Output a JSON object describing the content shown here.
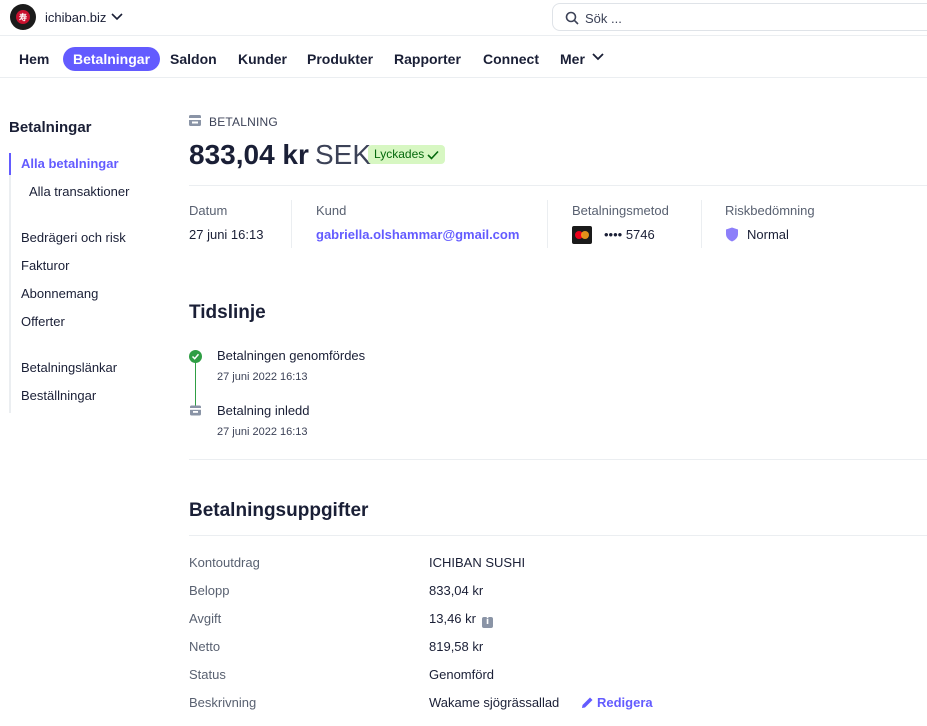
{
  "topbar": {
    "account_name": "ichiban.biz",
    "search_placeholder": "Sök ..."
  },
  "nav": {
    "items": [
      "Hem",
      "Betalningar",
      "Saldon",
      "Kunder",
      "Produkter",
      "Rapporter",
      "Connect",
      "Mer"
    ],
    "active": "Betalningar"
  },
  "sidebar": {
    "title": "Betalningar",
    "group1": [
      "Alla betalningar",
      "Alla transaktioner"
    ],
    "group2": [
      "Bedrägeri och risk",
      "Fakturor",
      "Abonnemang",
      "Offerter"
    ],
    "group3": [
      "Betalningslänkar",
      "Beställningar"
    ]
  },
  "payment": {
    "kind_label": "BETALNING",
    "amount": "833,04 kr",
    "currency": "SEK",
    "status_badge": "Lyckades",
    "meta": {
      "date_label": "Datum",
      "date_value": "27 juni 16:13",
      "customer_label": "Kund",
      "customer_value": "gabriella.olshammar@gmail.com",
      "method_label": "Betalningsmetod",
      "method_value": "•••• 5746",
      "risk_label": "Riskbedömning",
      "risk_value": "Normal"
    }
  },
  "timeline": {
    "title": "Tidslinje",
    "events": [
      {
        "title": "Betalningen genomfördes",
        "time": "27 juni 2022 16:13"
      },
      {
        "title": "Betalning inledd",
        "time": "27 juni 2022 16:13"
      }
    ]
  },
  "details": {
    "title": "Betalningsuppgifter",
    "rows": [
      {
        "label": "Kontoutdrag",
        "value": "ICHIBAN SUSHI"
      },
      {
        "label": "Belopp",
        "value": "833,04 kr"
      },
      {
        "label": "Avgift",
        "value": "13,46 kr"
      },
      {
        "label": "Netto",
        "value": "819,58 kr"
      },
      {
        "label": "Status",
        "value": "Genomförd"
      },
      {
        "label": "Beskrivning",
        "value": "Wakame sjögrässallad"
      }
    ],
    "edit_label": "Redigera"
  },
  "colors": {
    "accent": "#635bff",
    "success": "#2f9e44",
    "badge_bg": "#d7f7c2"
  }
}
